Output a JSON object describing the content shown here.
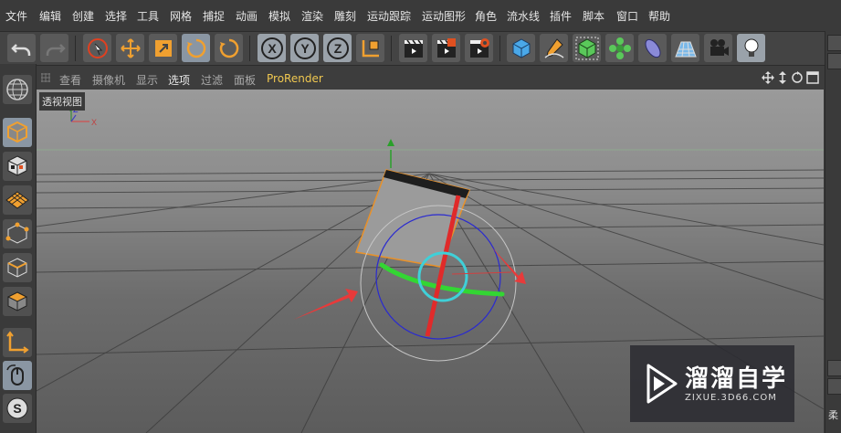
{
  "menu": [
    "文件",
    "编辑",
    "创建",
    "选择",
    "工具",
    "网格",
    "捕捉",
    "动画",
    "模拟",
    "渲染",
    "雕刻",
    "运动跟踪",
    "运动图形",
    "角色",
    "流水线",
    "插件",
    "脚本",
    "窗口",
    "帮助"
  ],
  "toolbar": {
    "axis_x": "X",
    "axis_y": "Y",
    "axis_z": "Z"
  },
  "viewport": {
    "menu": [
      "查看",
      "摄像机",
      "显示",
      "选项",
      "过滤",
      "面板",
      "ProRender"
    ],
    "selected_menu": "选项",
    "label": "透视视图",
    "axis_labels": {
      "x": "X",
      "y": "Y",
      "z": "Z"
    }
  },
  "left_tools": {
    "snap_label": "S"
  },
  "right_panel": {
    "label": "柔"
  },
  "watermark": {
    "title": "溜溜自学",
    "url": "ZIXUE.3D66.COM"
  },
  "colors": {
    "accent_orange": "#f0a030",
    "selection_cyan": "#3fd0d8",
    "rotation_green": "#33d633",
    "rotation_red": "#e02a2a",
    "rotation_blue": "#2a2ad0",
    "prorender_yellow": "#f0c850"
  }
}
